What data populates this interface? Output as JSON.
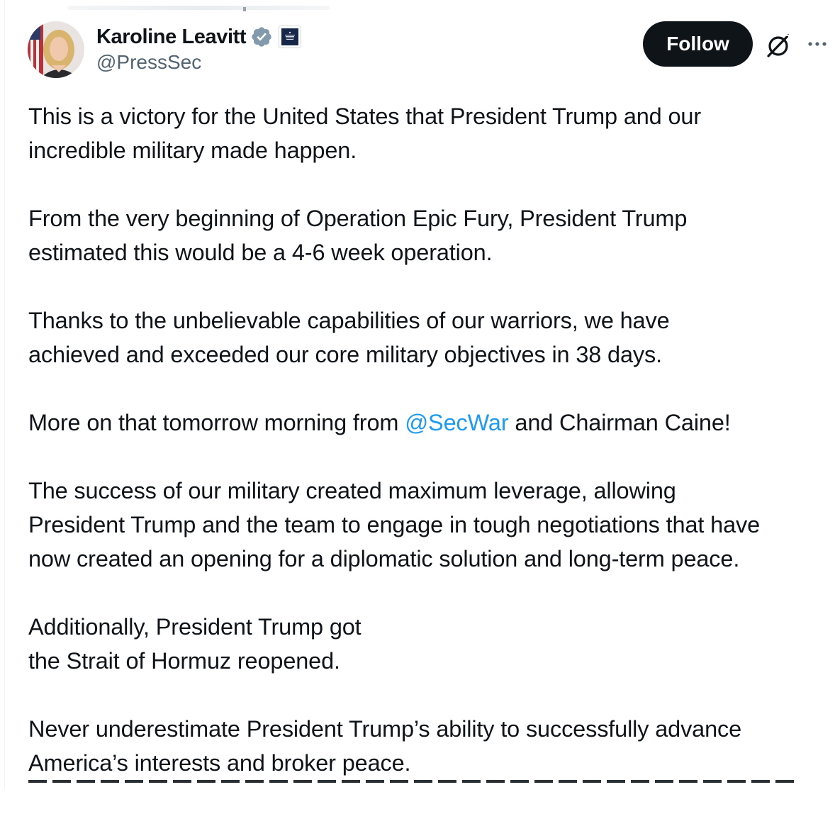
{
  "author": {
    "display_name": "Karoline Leavitt",
    "handle": "@PressSec",
    "verified_icon": "verified-badge-icon",
    "affiliation_icon": "white-house-affiliation-icon"
  },
  "actions": {
    "follow_label": "Follow",
    "grok_icon": "grok-icon",
    "more_icon": "more-options-icon"
  },
  "tweet": {
    "paragraphs": [
      [
        "This is a victory for the United States that President Trump and our",
        "incredible military made happen."
      ],
      [
        "From the very beginning of Operation Epic Fury, President Trump",
        "estimated this would be a 4-6 week operation."
      ],
      [
        "Thanks to the unbelievable capabilities of our warriors, we have",
        "achieved and exceeded our core military objectives in 38 days."
      ],
      [
        "The success of our military created maximum leverage, allowing",
        "President Trump and the team to engage in tough negotiations that have",
        "now created an opening for a diplomatic solution and long-term peace."
      ],
      [
        "Additionally, President Trump got",
        "the Strait of Hormuz reopened."
      ],
      [
        "Never underestimate President Trump’s ability to successfully advance",
        "America’s interests and broker peace."
      ]
    ],
    "mention_line": {
      "before": "More on that tomorrow morning from ",
      "mention": "@SecWar",
      "after": " and Chairman Caine!"
    }
  },
  "colors": {
    "accent": "#1d9bf0",
    "text": "#0f1419",
    "secondary": "#536471",
    "follow_bg": "#0f1419"
  }
}
